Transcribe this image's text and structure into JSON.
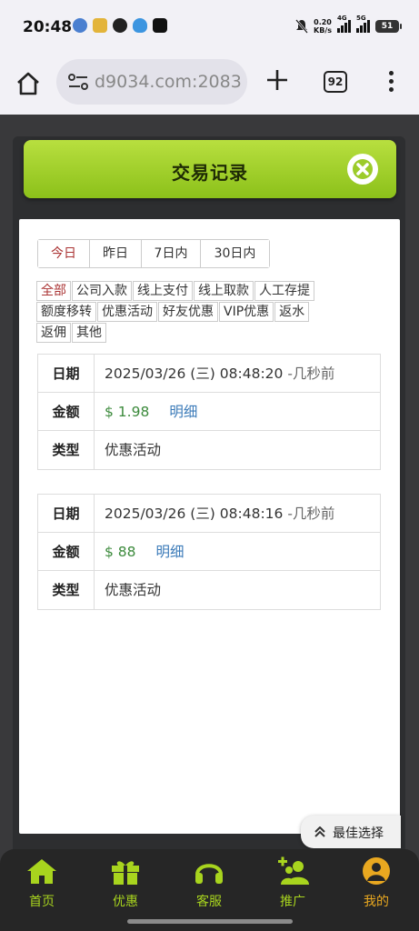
{
  "status_bar": {
    "time": "20:48",
    "net_speed_top": "0.20",
    "net_speed_bottom": "KB/s",
    "sig1": "4G",
    "sig2": "5G",
    "battery": "51"
  },
  "browser": {
    "url_prefix": "d9034.com",
    "url_suffix": ":2083",
    "tab_count": "92"
  },
  "modal": {
    "title": "交易记录"
  },
  "date_tabs": [
    {
      "label": "今日",
      "active": true
    },
    {
      "label": "昨日",
      "active": false
    },
    {
      "label": "7日内",
      "active": false
    },
    {
      "label": "30日内",
      "active": false
    }
  ],
  "type_filters": {
    "row1": [
      "全部",
      "公司入款",
      "线上支付",
      "线上取款",
      "人工存提"
    ],
    "row2": [
      "额度移转",
      "优惠活动",
      "好友优惠",
      "VIP优惠",
      "返水"
    ],
    "row3": [
      "返佣",
      "其他"
    ]
  },
  "records": [
    {
      "date_label": "日期",
      "date": "2025/03/26 (三) 08:48:20",
      "ago": "-几秒前",
      "amount_label": "金额",
      "amount": "$ 1.98",
      "detail": "明细",
      "type_label": "类型",
      "type": "优惠活动"
    },
    {
      "date_label": "日期",
      "date": "2025/03/26 (三) 08:48:16",
      "ago": "-几秒前",
      "amount_label": "金额",
      "amount": "$ 88",
      "detail": "明细",
      "type_label": "类型",
      "type": "优惠活动"
    }
  ],
  "best_choice": "最佳选择",
  "bottom_nav": [
    {
      "label": "首页",
      "icon": "home-icon"
    },
    {
      "label": "优惠",
      "icon": "gift-icon"
    },
    {
      "label": "客服",
      "icon": "headset-icon"
    },
    {
      "label": "推广",
      "icon": "add-users-icon"
    },
    {
      "label": "我的",
      "icon": "user-icon"
    }
  ],
  "colors": {
    "accent_green": "#a8d41e",
    "active_red": "#a33333",
    "amount_green": "#3c8a3c",
    "link_blue": "#3a7ab8"
  }
}
